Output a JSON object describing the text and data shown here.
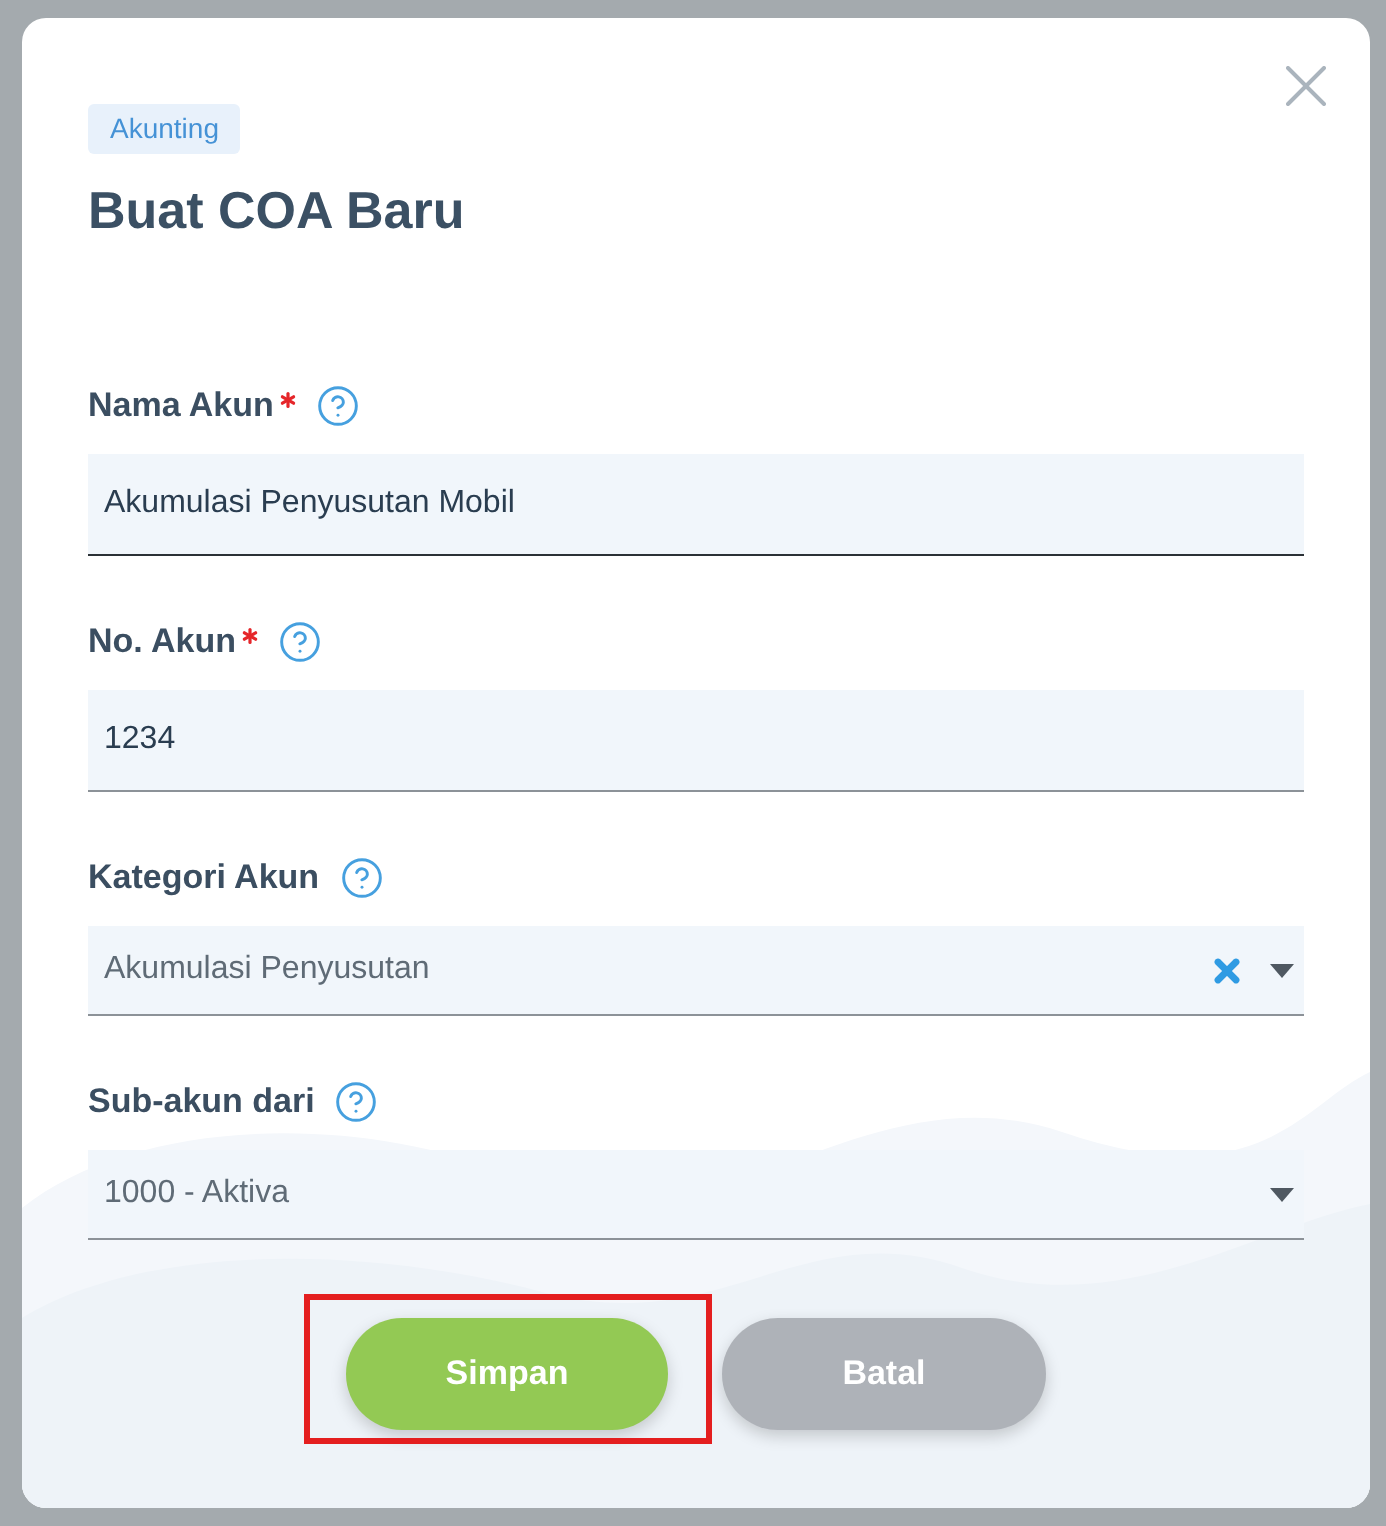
{
  "dialog": {
    "badge": "Akunting",
    "title": "Buat COA Baru"
  },
  "fields": [
    {
      "kind": "text",
      "label": "Nama Akun",
      "required": true,
      "value": "Akumulasi Penyusutan Mobil",
      "focused": true
    },
    {
      "kind": "text",
      "label": "No. Akun",
      "required": true,
      "value": "1234",
      "focused": false
    },
    {
      "kind": "select",
      "label": "Kategori Akun",
      "required": false,
      "value": "Akumulasi Penyusutan",
      "clearable": true,
      "focused": false
    },
    {
      "kind": "select",
      "label": "Sub-akun dari",
      "required": false,
      "value": "1000 - Aktiva",
      "clearable": false,
      "focused": false
    }
  ],
  "buttons": [
    {
      "kind": "primary",
      "label": "Simpan",
      "highlighted": true
    },
    {
      "kind": "secondary",
      "label": "Batal",
      "highlighted": false
    }
  ]
}
